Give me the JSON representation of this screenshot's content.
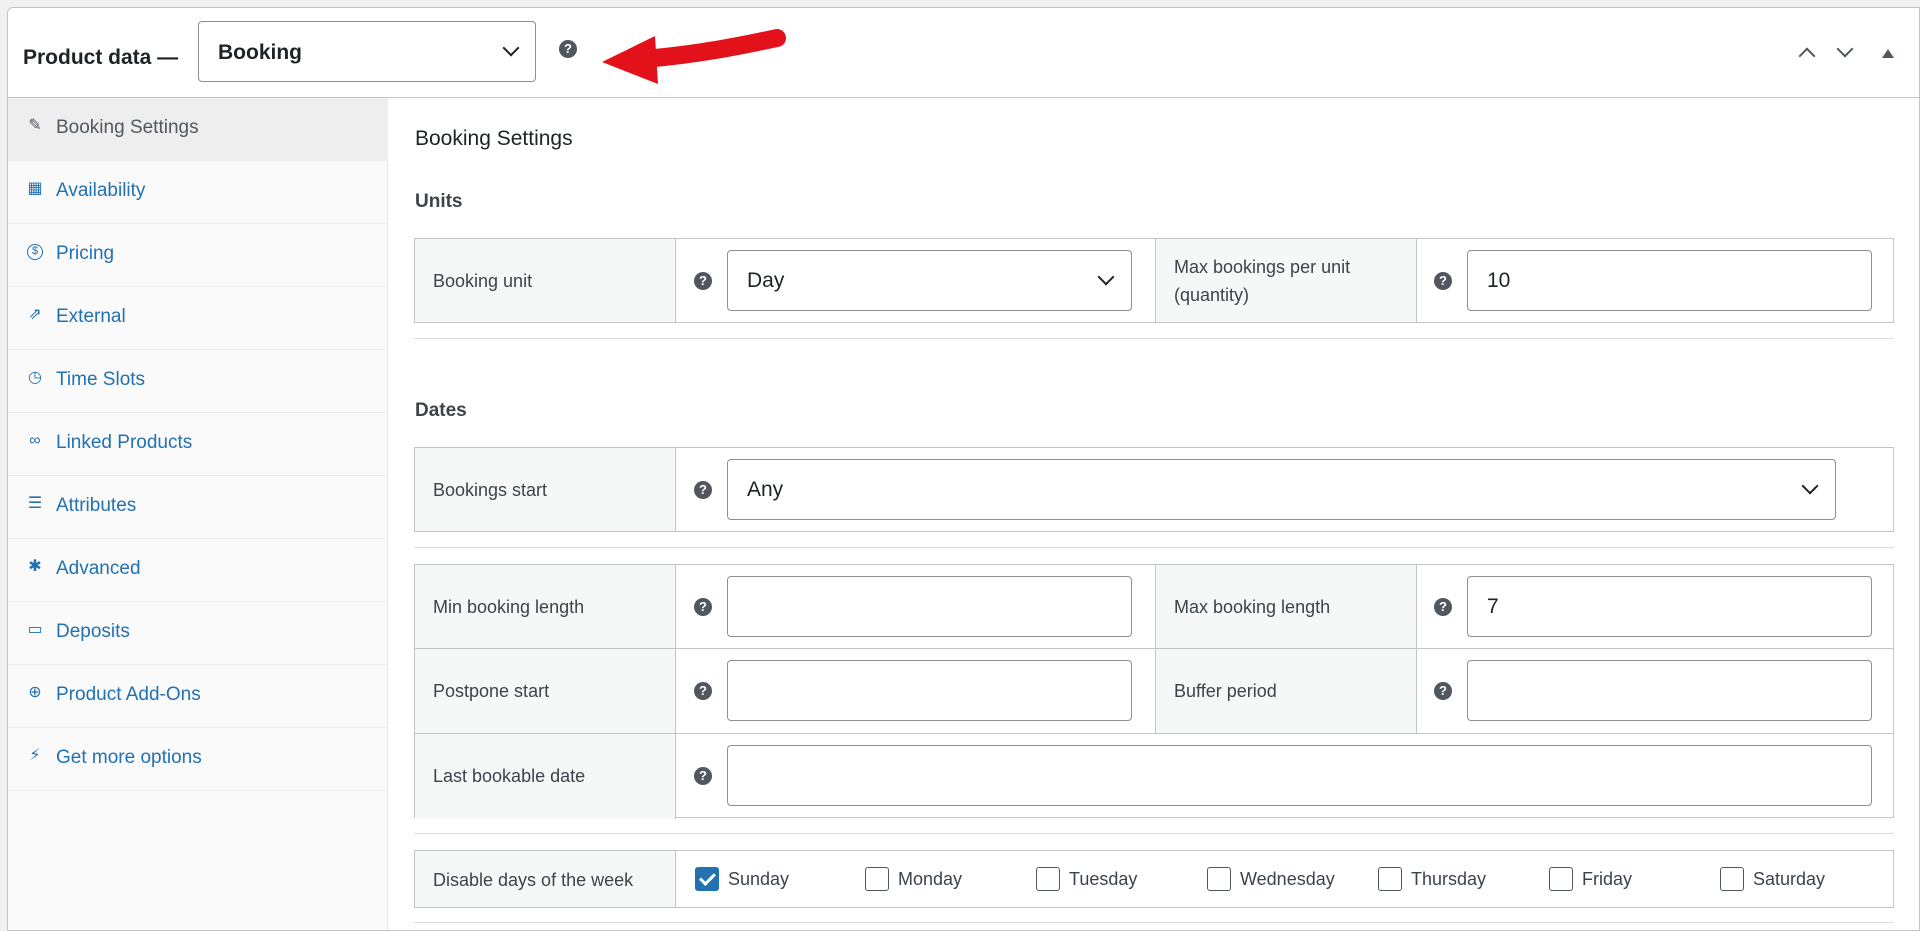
{
  "header": {
    "title": "Product data —",
    "product_type": "Booking",
    "help": "?"
  },
  "sidebar": {
    "items": [
      {
        "label": "Booking Settings",
        "icon": "wrench-icon",
        "glyph": "🔧"
      },
      {
        "label": "Availability",
        "icon": "calendar-icon",
        "glyph": "▦"
      },
      {
        "label": "Pricing",
        "icon": "dollar-icon",
        "glyph": "$"
      },
      {
        "label": "External",
        "icon": "external-link-icon",
        "glyph": "⇗"
      },
      {
        "label": "Time Slots",
        "icon": "clock-icon",
        "glyph": "◷"
      },
      {
        "label": "Linked Products",
        "icon": "link-icon",
        "glyph": "∞"
      },
      {
        "label": "Attributes",
        "icon": "list-icon",
        "glyph": "☰"
      },
      {
        "label": "Advanced",
        "icon": "gear-icon",
        "glyph": "✱"
      },
      {
        "label": "Deposits",
        "icon": "card-icon",
        "glyph": "▭"
      },
      {
        "label": "Product Add-Ons",
        "icon": "plus-circle-icon",
        "glyph": "⊕"
      },
      {
        "label": "Get more options",
        "icon": "plug-icon",
        "glyph": "⚡"
      }
    ]
  },
  "content": {
    "section_title": "Booking Settings",
    "units_heading": "Units",
    "booking_unit_label": "Booking unit",
    "booking_unit_value": "Day",
    "max_bookings_label_1": "Max bookings per unit",
    "max_bookings_label_2": "(quantity)",
    "max_bookings_value": "10",
    "dates_heading": "Dates",
    "bookings_start_label": "Bookings start",
    "bookings_start_value": "Any",
    "min_length_label": "Min booking length",
    "min_length_value": "",
    "max_length_label": "Max booking length",
    "max_length_value": "7",
    "postpone_label": "Postpone start",
    "postpone_value": "",
    "buffer_label": "Buffer period",
    "buffer_value": "",
    "last_date_label": "Last bookable date",
    "last_date_value": "",
    "disable_days_label": "Disable days of the week",
    "days": [
      {
        "label": "Sunday",
        "checked": true
      },
      {
        "label": "Monday",
        "checked": false
      },
      {
        "label": "Tuesday",
        "checked": false
      },
      {
        "label": "Wednesday",
        "checked": false
      },
      {
        "label": "Thursday",
        "checked": false
      },
      {
        "label": "Friday",
        "checked": false
      },
      {
        "label": "Saturday",
        "checked": false
      }
    ]
  },
  "colors": {
    "link": "#2271b1",
    "annotation_arrow": "#e3111a",
    "checkbox_checked": "#2271b1"
  }
}
